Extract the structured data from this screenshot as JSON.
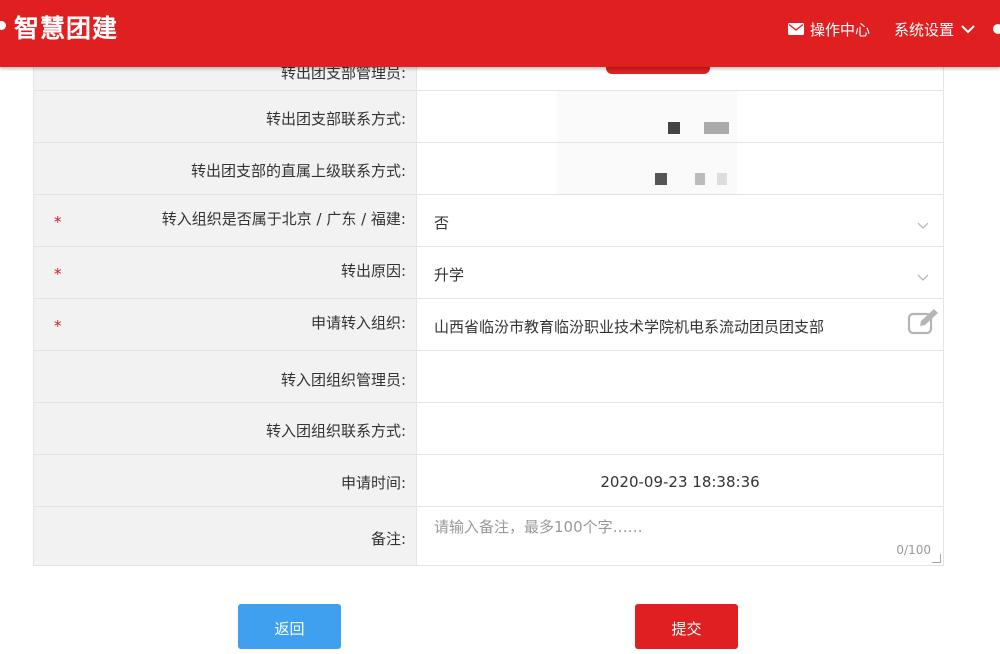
{
  "header": {
    "brand": "智慧团建",
    "ops_center": "操作中心",
    "system_settings": "系统设置"
  },
  "form": {
    "rows": [
      {
        "label": "转出团支部管理员:",
        "value": ""
      },
      {
        "label": "转出团支部联系方式:",
        "value": ""
      },
      {
        "label": "转出团支部的直属上级联系方式:",
        "value": ""
      },
      {
        "label": "转入组织是否属于北京 / 广东 / 福建:",
        "value": "否",
        "required": true
      },
      {
        "label": "转出原因:",
        "value": "升学",
        "required": true
      },
      {
        "label": "申请转入组织:",
        "value": "山西省临汾市教育临汾职业技术学院机电系流动团员团支部",
        "required": true
      },
      {
        "label": "转入团组织管理员:",
        "value": ""
      },
      {
        "label": "转入团组织联系方式:",
        "value": ""
      },
      {
        "label": "申请时间:",
        "value": "2020-09-23 18:38:36"
      },
      {
        "label": "备注:",
        "placeholder": "请输入备注，最多100个字……",
        "counter": "0/100"
      }
    ],
    "required_mark": "*"
  },
  "buttons": {
    "back": "返回",
    "submit": "提交"
  },
  "colors": {
    "brand_red": "#e02020",
    "button_blue": "#3fa0ef"
  }
}
